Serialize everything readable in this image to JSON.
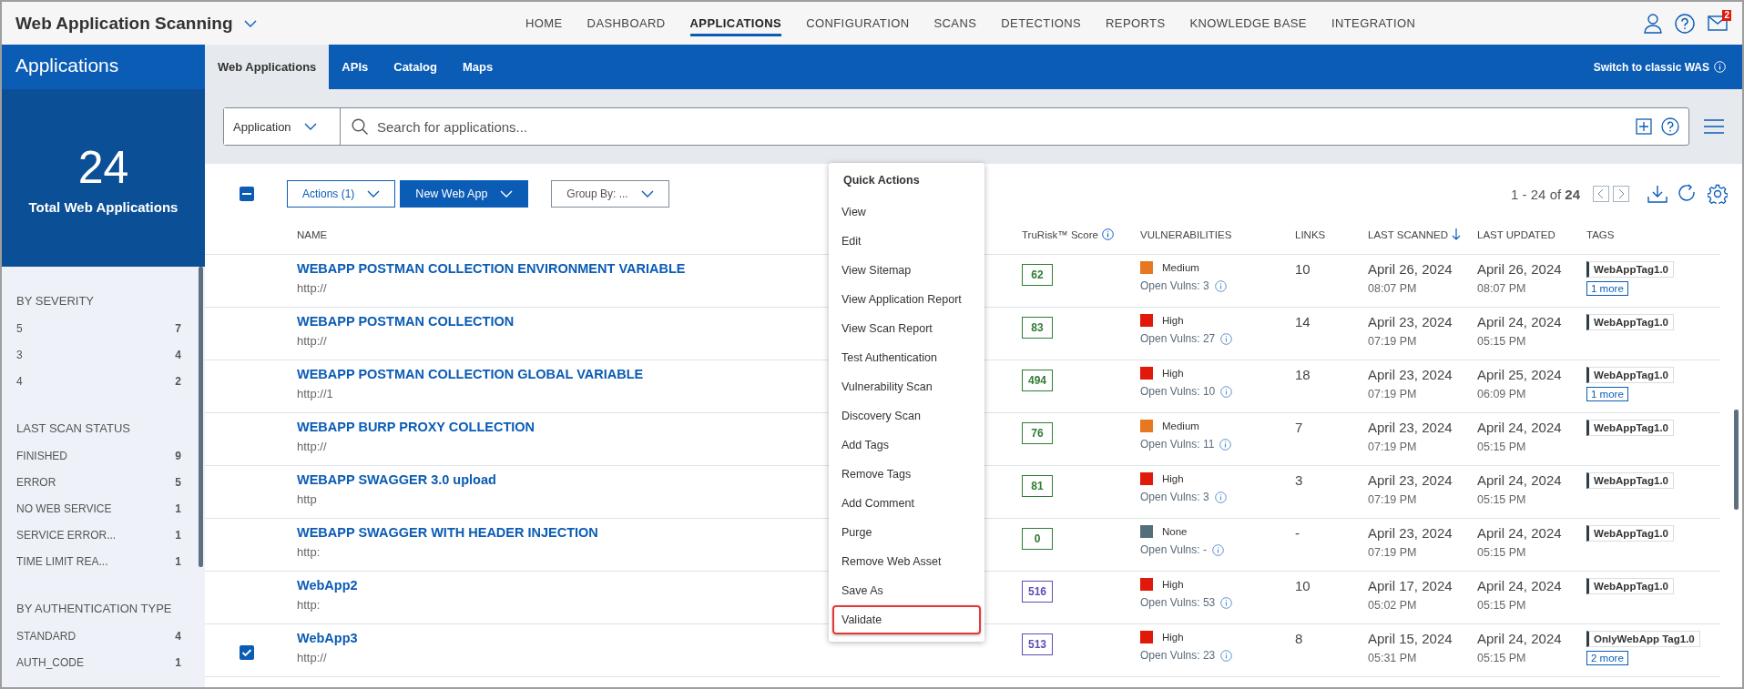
{
  "app": {
    "title": "Web Application Scanning"
  },
  "nav": [
    {
      "label": "HOME",
      "selected": false
    },
    {
      "label": "DASHBOARD",
      "selected": false
    },
    {
      "label": "APPLICATIONS",
      "selected": true
    },
    {
      "label": "CONFIGURATION",
      "selected": false
    },
    {
      "label": "SCANS",
      "selected": false
    },
    {
      "label": "DETECTIONS",
      "selected": false
    },
    {
      "label": "REPORTS",
      "selected": false
    },
    {
      "label": "KNOWLEDGE BASE",
      "selected": false
    },
    {
      "label": "INTEGRATION",
      "selected": false
    }
  ],
  "mail_badge": "2",
  "sidebar": {
    "title": "Applications",
    "total": "24",
    "total_label": "Total Web Applications",
    "sections": [
      {
        "heading": "BY SEVERITY",
        "items": [
          {
            "label": "5",
            "count": "7"
          },
          {
            "label": "3",
            "count": "4"
          },
          {
            "label": "4",
            "count": "2"
          }
        ]
      },
      {
        "heading": "LAST SCAN STATUS",
        "items": [
          {
            "label": "FINISHED",
            "count": "9"
          },
          {
            "label": "ERROR",
            "count": "5"
          },
          {
            "label": "NO WEB SERVICE",
            "count": "1"
          },
          {
            "label": "SERVICE ERROR...",
            "count": "1"
          },
          {
            "label": "TIME LIMIT REA...",
            "count": "1"
          }
        ]
      },
      {
        "heading": "BY AUTHENTICATION TYPE",
        "items": [
          {
            "label": "STANDARD",
            "count": "4"
          },
          {
            "label": "AUTH_CODE",
            "count": "1"
          }
        ]
      }
    ]
  },
  "tabs": [
    {
      "label": "Web Applications",
      "selected": true
    },
    {
      "label": "APIs",
      "selected": false
    },
    {
      "label": "Catalog",
      "selected": false
    },
    {
      "label": "Maps",
      "selected": false
    }
  ],
  "switch_link": "Switch to classic WAS",
  "search": {
    "filter": "Application",
    "placeholder": "Search for applications..."
  },
  "toolbar": {
    "select_all_partial": true,
    "actions": "Actions (1)",
    "new_button": "New Web App",
    "group_by": "Group By: ...",
    "pagination": "1 - 24 of **24**"
  },
  "table": {
    "columns": [
      "NAME",
      "TruRisk™ Score",
      "VULNERABILITIES",
      "LINKS",
      "LAST SCANNED",
      "LAST UPDATED",
      "TAGS"
    ],
    "rows": [
      {
        "checked": false,
        "name": "WEBAPP POSTMAN COLLECTION ENVIRONMENT VARIABLE",
        "url": "http://",
        "score": {
          "value": "62",
          "color": "#2e7d32"
        },
        "severity": {
          "label": "Medium",
          "color": "#e87722"
        },
        "open_vulns": "Open Vulns: 3",
        "links": "10",
        "scanned_date": "April 26, 2024",
        "scanned_time": "08:07 PM",
        "updated_date": "April 26, 2024",
        "updated_time": "08:07 PM",
        "tag": "WebAppTag1.0",
        "more": "1 more"
      },
      {
        "checked": false,
        "name": "WEBAPP POSTMAN COLLECTION",
        "url": "http://",
        "score": {
          "value": "83",
          "color": "#2e7d32"
        },
        "severity": {
          "label": "High",
          "color": "#e0190b"
        },
        "open_vulns": "Open Vulns: 27",
        "links": "14",
        "scanned_date": "April 23, 2024",
        "scanned_time": "07:19 PM",
        "updated_date": "April 24, 2024",
        "updated_time": "05:15 PM",
        "tag": "WebAppTag1.0"
      },
      {
        "checked": false,
        "name": "WEBAPP POSTMAN COLLECTION GLOBAL VARIABLE",
        "url": "http://1",
        "score": {
          "value": "494",
          "color": "#2e7d32"
        },
        "severity": {
          "label": "High",
          "color": "#e0190b"
        },
        "open_vulns": "Open Vulns: 10",
        "links": "18",
        "scanned_date": "April 23, 2024",
        "scanned_time": "07:19 PM",
        "updated_date": "April 25, 2024",
        "updated_time": "06:09 PM",
        "tag": "WebAppTag1.0",
        "more": "1 more"
      },
      {
        "checked": false,
        "name": "WEBAPP BURP PROXY COLLECTION",
        "url": "http://",
        "score": {
          "value": "76",
          "color": "#2e7d32"
        },
        "severity": {
          "label": "Medium",
          "color": "#e87722"
        },
        "open_vulns": "Open Vulns: 11",
        "links": "7",
        "scanned_date": "April 23, 2024",
        "scanned_time": "07:19 PM",
        "updated_date": "April 24, 2024",
        "updated_time": "05:15 PM",
        "tag": "WebAppTag1.0"
      },
      {
        "checked": false,
        "name": "WEBAPP SWAGGER 3.0 upload",
        "url": "http",
        "score": {
          "value": "81",
          "color": "#2e7d32"
        },
        "severity": {
          "label": "High",
          "color": "#e0190b"
        },
        "open_vulns": "Open Vulns: 3",
        "links": "3",
        "scanned_date": "April 23, 2024",
        "scanned_time": "07:19 PM",
        "updated_date": "April 24, 2024",
        "updated_time": "05:15 PM",
        "tag": "WebAppTag1.0"
      },
      {
        "checked": false,
        "name": "WEBAPP SWAGGER WITH HEADER INJECTION",
        "url": "http:",
        "score": {
          "value": "0",
          "color": "#2e7d32"
        },
        "severity": {
          "label": "None",
          "color": "#546e7a"
        },
        "open_vulns": "Open Vulns: -",
        "links": "-",
        "scanned_date": "April 23, 2024",
        "scanned_time": "07:19 PM",
        "updated_date": "April 24, 2024",
        "updated_time": "05:15 PM",
        "tag": "WebAppTag1.0"
      },
      {
        "checked": false,
        "name": "WebApp2",
        "url": "http:",
        "score": {
          "value": "516",
          "color": "#5c4db1"
        },
        "severity": {
          "label": "High",
          "color": "#e0190b"
        },
        "open_vulns": "Open Vulns: 53",
        "links": "10",
        "scanned_date": "April 17, 2024",
        "scanned_time": "05:02 PM",
        "updated_date": "April 24, 2024",
        "updated_time": "05:15 PM",
        "tag": "WebAppTag1.0"
      },
      {
        "checked": true,
        "name": "WebApp3",
        "url": "http://",
        "score": {
          "value": "513",
          "color": "#5c4db1"
        },
        "severity": {
          "label": "High",
          "color": "#e0190b"
        },
        "open_vulns": "Open Vulns: 23",
        "links": "8",
        "scanned_date": "April 15, 2024",
        "scanned_time": "05:31 PM",
        "updated_date": "April 24, 2024",
        "updated_time": "05:15 PM",
        "tag": "OnlyWebApp Tag1.0",
        "more": "2 more"
      }
    ]
  },
  "quick_actions": {
    "title": "Quick Actions",
    "items": [
      {
        "label": "View",
        "highlighted": false
      },
      {
        "label": "Edit",
        "highlighted": false
      },
      {
        "label": "View Sitemap",
        "highlighted": false
      },
      {
        "label": "View Application Report",
        "highlighted": false
      },
      {
        "label": "View Scan Report",
        "highlighted": false
      },
      {
        "label": "Test Authentication",
        "highlighted": false
      },
      {
        "label": "Vulnerability Scan",
        "highlighted": false
      },
      {
        "label": "Discovery Scan",
        "highlighted": false
      },
      {
        "label": "Add Tags",
        "highlighted": false
      },
      {
        "label": "Remove Tags",
        "highlighted": false
      },
      {
        "label": "Add Comment",
        "highlighted": false
      },
      {
        "label": "Purge",
        "highlighted": false
      },
      {
        "label": "Remove Web Asset",
        "highlighted": false
      },
      {
        "label": "Save As",
        "highlighted": false
      },
      {
        "label": "Validate",
        "highlighted": true
      }
    ]
  }
}
